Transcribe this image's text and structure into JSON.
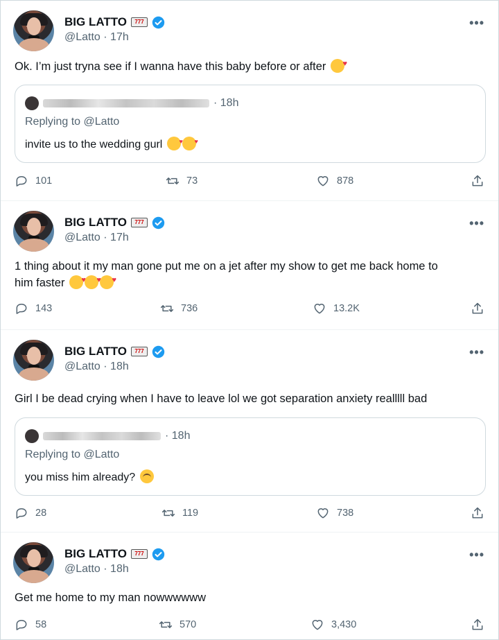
{
  "colors": {
    "text": "#0f1419",
    "secondary": "#536471",
    "verified": "#1d9bf0",
    "border": "#cfd9de"
  },
  "tweets": [
    {
      "name": "BIG LATTO",
      "handle": "@Latto",
      "time": "17h",
      "text": "Ok. I’m just tryna see if I wanna have this baby before or after",
      "emojis": [
        "smiling-face-with-hearts"
      ],
      "quote": {
        "time": "· 18h",
        "replying": "Replying to @Latto",
        "text": "invite us to the wedding gurl",
        "emojis": [
          "kissing-face",
          "kissing-face"
        ]
      },
      "replies": "101",
      "retweets": "73",
      "likes": "878"
    },
    {
      "name": "BIG LATTO",
      "handle": "@Latto",
      "time": "17h",
      "text_line1": "1 thing about it my man gone put me on a jet after my show to get me back home to",
      "text_line2": "him faster",
      "emojis": [
        "smiling-face-with-hearts",
        "smiling-face-with-hearts",
        "smiling-face-with-hearts"
      ],
      "replies": "143",
      "retweets": "736",
      "likes": "13.2K"
    },
    {
      "name": "BIG LATTO",
      "handle": "@Latto",
      "time": "18h",
      "text": "Girl I be dead crying when I have to leave lol we got separation anxiety realllll bad",
      "quote": {
        "time": "· 18h",
        "replying": "Replying to @Latto",
        "text": "you miss him already?",
        "emojis": [
          "face-with-rolling-eyes"
        ]
      },
      "replies": "28",
      "retweets": "119",
      "likes": "738"
    },
    {
      "name": "BIG LATTO",
      "handle": "@Latto",
      "time": "18h",
      "text": "Get me home to my man nowwwwww",
      "replies": "58",
      "retweets": "570",
      "likes": "3,430"
    }
  ]
}
